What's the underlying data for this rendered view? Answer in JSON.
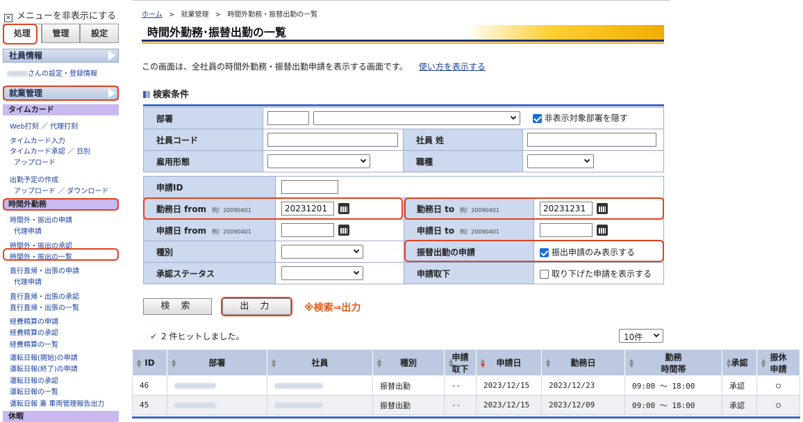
{
  "sidebar": {
    "hide_menu": "メニューを非表示にする",
    "tabs": [
      "処理",
      "管理",
      "設定"
    ],
    "employee_info": "社員情報",
    "user_settings": "さんの設定・登録情報",
    "work_mgmt": "就業管理",
    "timecard": "タイムカード",
    "links1": [
      "Web打刻 ／ 代理打刻",
      "タイムカード入力",
      "タイムカード承認 ／ 日別",
      "アップロード"
    ],
    "schedule": [
      "出勤予定の作成",
      "アップロード ／ ダウンロード"
    ],
    "overtime": "時間外勤務",
    "links2": [
      "時間外・振出の申請",
      "代理申請",
      "時間外・振出の承認",
      "時間外・振出の一覧"
    ],
    "links3": [
      "直行直帰・出張の申請",
      "代理申請",
      "直行直帰・出張の承認",
      "直行直帰・出張の一覧",
      "経費精算の申請",
      "経費精算の承認",
      "経費精算の一覧",
      "運転日報(開始)の申請",
      "運転日報(終了)の申請",
      "運転日報の承認",
      "運転日報の一覧",
      "運転日報 兼 車両管理報告出力"
    ],
    "leave": "休暇"
  },
  "breadcrumb": {
    "home": "ホーム",
    "sep": ">",
    "items": [
      "就業管理",
      "時間外勤務・振替出勤の一覧"
    ]
  },
  "page_title": "時間外勤務･振替出勤の一覧",
  "intro": {
    "text": "この画面は、全社員の時間外勤務・振替出勤申請を表示する画面です。",
    "link": "使い方を表示する"
  },
  "search": {
    "title": "検索条件",
    "dept": "部署",
    "hide_dept": "非表示対象部署を隠す",
    "emp_code": "社員コード",
    "emp_last": "社員 姓",
    "emp_type": "雇用形態",
    "job": "職種",
    "app_id": "申請ID",
    "work_from": "勤務日 from",
    "work_to": "勤務日 to",
    "example": "例）20090401",
    "work_from_val": "20231201",
    "work_to_val": "20231231",
    "app_from": "申請日 from",
    "app_to": "申請日 to",
    "kind": "種別",
    "transfer": "振替出勤の申請",
    "transfer_chk": "振出申請のみ表示する",
    "status": "承認ステータス",
    "withdraw": "申請取下",
    "withdraw_chk": "取り下げた申請を表示する"
  },
  "buttons": {
    "search": "検 索",
    "output": "出 力"
  },
  "note": "※検索⇒出力",
  "hits": "2 件ヒットしました。",
  "per_page": "10件",
  "table": {
    "headers": {
      "id": "ID",
      "dept": "部署",
      "emp": "社員",
      "kind": "種別",
      "withdraw1": "申請",
      "withdraw2": "取下",
      "app_date": "申請日",
      "work_date": "勤務日",
      "time1": "勤務",
      "time2": "時間帯",
      "approve": "承認",
      "transfer1": "振休",
      "transfer2": "申請"
    },
    "rows": [
      {
        "id": "46",
        "kind": "振替出勤",
        "withdraw": "--",
        "app_date": "2023/12/15",
        "work_date": "2023/12/23",
        "time": "09:00 〜 18:00",
        "approve": "承認",
        "transfer": "○"
      },
      {
        "id": "45",
        "kind": "振替出勤",
        "withdraw": "--",
        "app_date": "2023/12/15",
        "work_date": "2023/12/09",
        "time": "09:00 〜 18:00",
        "approve": "承認",
        "transfer": "○"
      }
    ]
  }
}
